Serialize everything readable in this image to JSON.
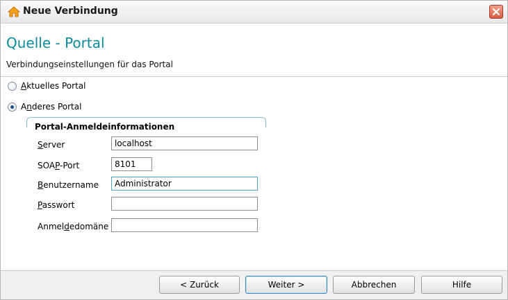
{
  "window": {
    "title": "Neue Verbindung"
  },
  "header": {
    "title": "Quelle - Portal",
    "subtitle": "Verbindungseinstellungen für das Portal"
  },
  "options": {
    "current_portal": {
      "prefix": "",
      "mnemonic": "A",
      "rest": "ktuelles Portal",
      "checked": false
    },
    "other_portal": {
      "prefix": "A",
      "mnemonic": "n",
      "rest": "deres Portal",
      "checked": true
    }
  },
  "group": {
    "title": "Portal-Anmeldeinformationen"
  },
  "fields": {
    "server": {
      "prefix": "",
      "mnemonic": "S",
      "rest": "erver",
      "value": "localhost"
    },
    "soap_port": {
      "prefix": "SOA",
      "mnemonic": "P",
      "rest": "-Port",
      "value": "8101"
    },
    "username": {
      "prefix": "",
      "mnemonic": "B",
      "rest": "enutzername",
      "value": "Administrator"
    },
    "password": {
      "prefix": "",
      "mnemonic": "P",
      "rest": "asswort",
      "value": ""
    },
    "domain": {
      "prefix": "Anmel",
      "mnemonic": "d",
      "rest": "edomäne",
      "value": ""
    }
  },
  "buttons": {
    "back": "< Zurück",
    "next": "Weiter >",
    "cancel": "Abbrechen",
    "help": "Hilfe"
  },
  "colors": {
    "accent": "#0e8c9a",
    "group_border": "#7cc4d3",
    "focus_border": "#4aa5bf"
  },
  "icons": {
    "app": "house-icon",
    "close": "close-icon"
  }
}
